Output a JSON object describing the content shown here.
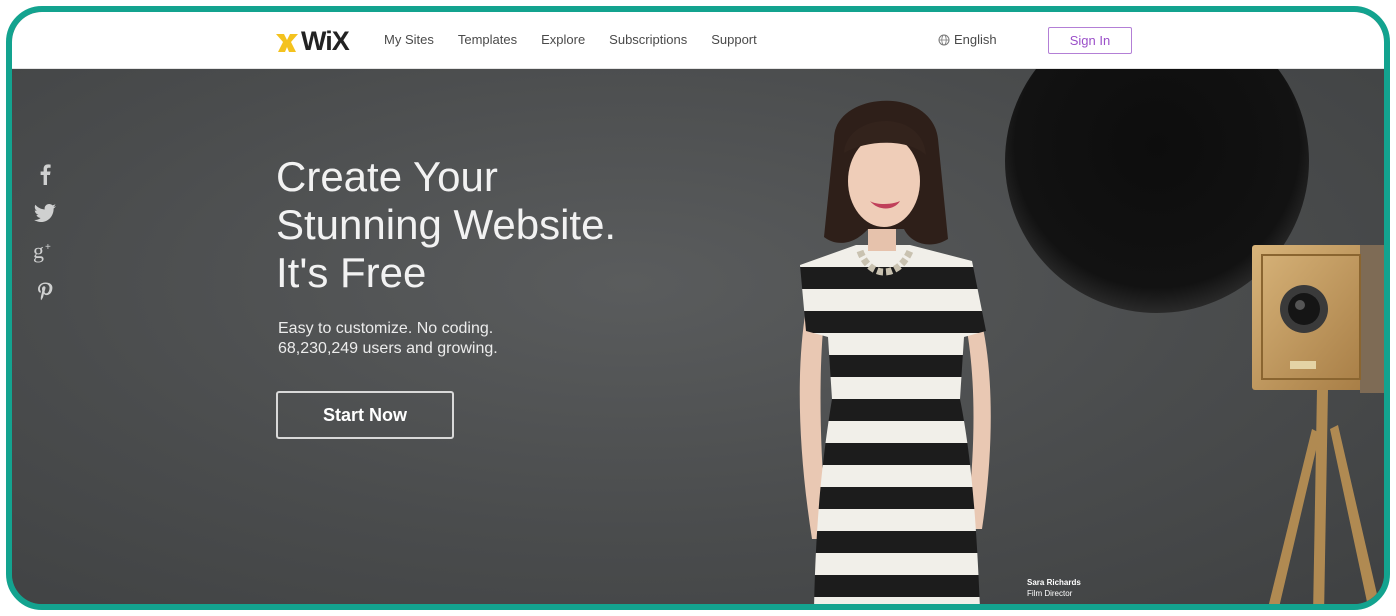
{
  "nav": {
    "logo_text": "WiX",
    "items": [
      "My Sites",
      "Templates",
      "Explore",
      "Subscriptions",
      "Support"
    ],
    "language": "English",
    "sign_in": "Sign In"
  },
  "social_icons": [
    "facebook-icon",
    "twitter-icon",
    "google-plus-icon",
    "pinterest-icon"
  ],
  "hero": {
    "headline": [
      "Create Your",
      "Stunning Website.",
      "It's Free"
    ],
    "subline": [
      "Easy to customize. No coding.",
      "68,230,249 users and growing."
    ],
    "cta": "Start Now"
  },
  "caption": {
    "name": "Sara Richards",
    "role": "Film Director"
  },
  "colors": {
    "frame_border": "#13a38f",
    "signin_purple": "#9b4fc9",
    "hero_bg": "#4a4c4d",
    "logo_yellow": "#f4c21e"
  }
}
